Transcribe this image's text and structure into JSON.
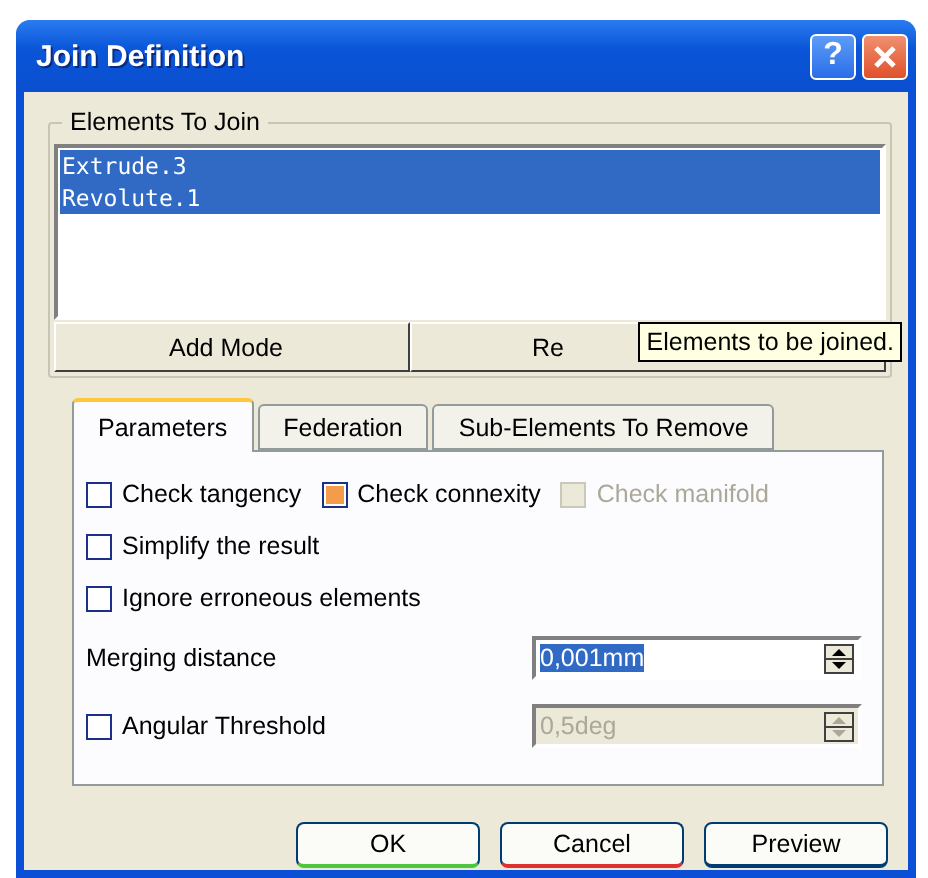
{
  "window": {
    "title": "Join Definition",
    "help_button": "?"
  },
  "elements_group": {
    "label": "Elements To Join",
    "items": [
      {
        "label": "Extrude.3",
        "selected": true
      },
      {
        "label": "Revolute.1",
        "selected": true
      }
    ],
    "buttons": [
      {
        "label": "Add Mode"
      },
      {
        "label": "Re"
      }
    ],
    "tooltip": "Elements to be joined."
  },
  "tabs": [
    {
      "label": "Parameters",
      "selected": true
    },
    {
      "label": "Federation",
      "selected": false
    },
    {
      "label": "Sub-Elements To Remove",
      "selected": false
    }
  ],
  "checkbox_rows": [
    {
      "items": [
        {
          "label": "Check tangency",
          "checked": false,
          "disabled": false
        },
        {
          "label": "Check connexity",
          "checked": true,
          "disabled": false
        },
        {
          "label": "Check manifold",
          "checked": false,
          "disabled": true
        }
      ]
    },
    {
      "items": [
        {
          "label": "Simplify the result",
          "checked": false,
          "disabled": false
        }
      ]
    },
    {
      "items": [
        {
          "label": "Ignore erroneous elements",
          "checked": false,
          "disabled": false
        }
      ]
    }
  ],
  "merging_distance": {
    "label": "Merging distance",
    "value": "0,001mm",
    "selected": true,
    "disabled": false
  },
  "angular_threshold": {
    "label": "Angular Threshold",
    "checked": false,
    "value": "0,5deg",
    "disabled": true
  },
  "buttons": [
    {
      "label": "OK",
      "kind": "ok"
    },
    {
      "label": "Cancel",
      "kind": "cancel"
    },
    {
      "label": "Preview",
      "kind": "preview"
    }
  ]
}
